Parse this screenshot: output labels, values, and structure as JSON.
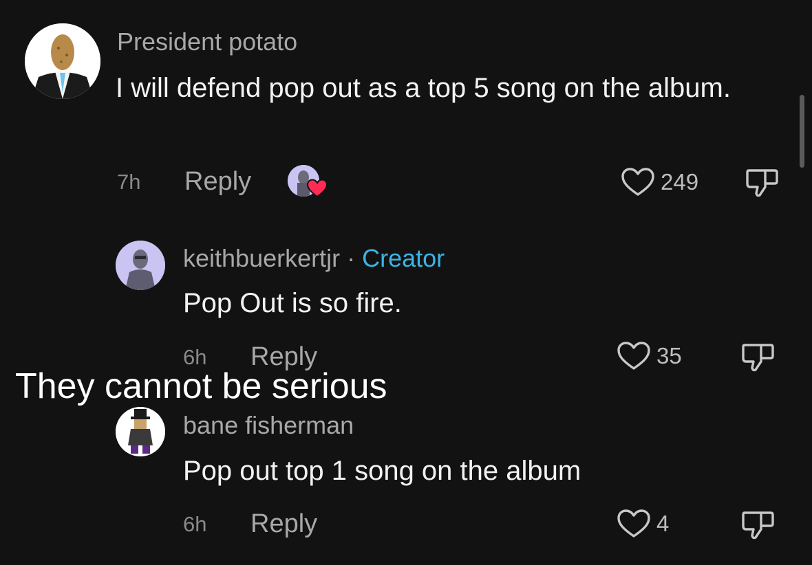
{
  "comments": [
    {
      "username": "President potato",
      "text": "I will defend pop out as a top 5 song on the album.",
      "time": "7h",
      "reply_label": "Reply",
      "likes": "249"
    },
    {
      "username": "keithbuerkertjr",
      "separator": "·",
      "badge": "Creator",
      "text": "Pop Out is so fire.",
      "time": "6h",
      "reply_label": "Reply",
      "likes": "35"
    },
    {
      "username": "bane fisherman",
      "text": "Pop out top 1 song on the album",
      "time": "6h",
      "reply_label": "Reply",
      "likes": "4"
    }
  ],
  "overlay": {
    "caption": "They cannot be serious"
  },
  "icons": {
    "like": "heart-outline-icon",
    "dislike": "thumbs-down-icon",
    "creator_liked": "creator-liked-heart-icon"
  },
  "colors": {
    "background": "#121212",
    "creator_badge": "#3cb4e5",
    "liked_heart": "#fe2c55"
  }
}
